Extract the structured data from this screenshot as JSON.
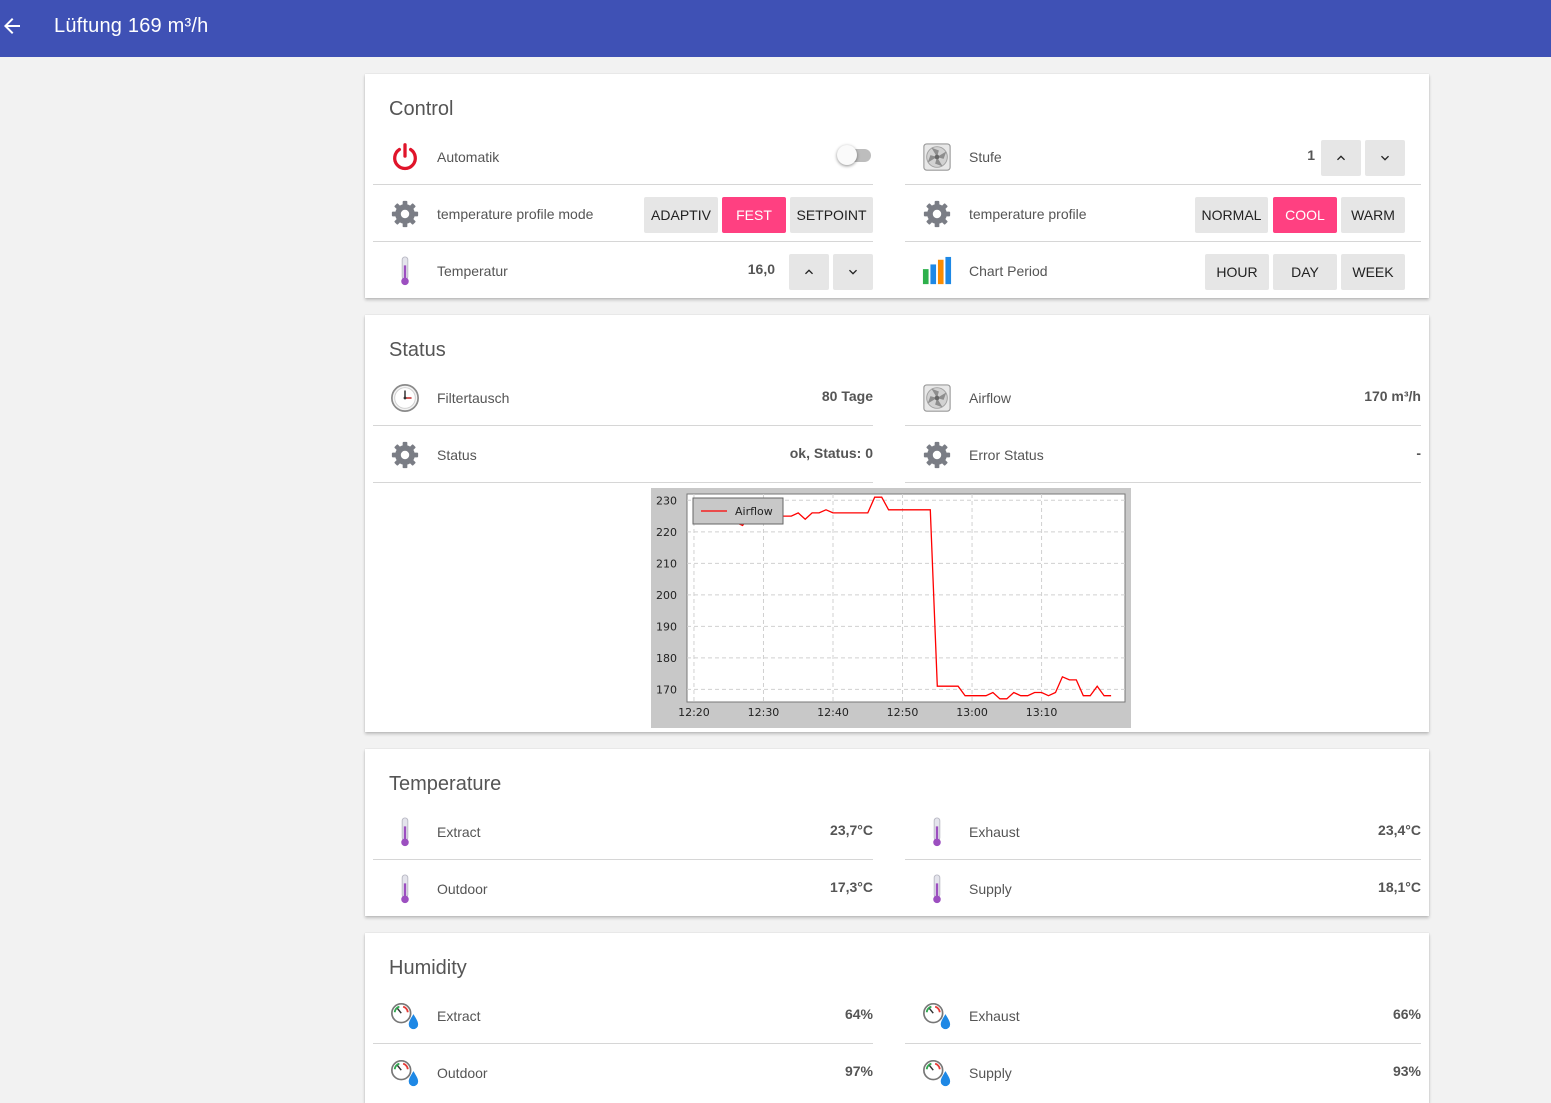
{
  "header": {
    "title": "Lüftung 169 m³/h"
  },
  "control": {
    "title": "Control",
    "automatik": {
      "label": "Automatik",
      "enabled": false
    },
    "stufe": {
      "label": "Stufe",
      "value": "1"
    },
    "profile_mode": {
      "label": "temperature profile mode",
      "options": [
        "ADAPTIV",
        "FEST",
        "SETPOINT"
      ],
      "selected": "FEST"
    },
    "profile": {
      "label": "temperature profile",
      "options": [
        "NORMAL",
        "COOL",
        "WARM"
      ],
      "selected": "COOL"
    },
    "temperatur": {
      "label": "Temperatur",
      "value": "16,0"
    },
    "chart_period": {
      "label": "Chart Period",
      "options": [
        "HOUR",
        "DAY",
        "WEEK"
      ]
    }
  },
  "status": {
    "title": "Status",
    "filtertausch": {
      "label": "Filtertausch",
      "value": "80 Tage"
    },
    "airflow": {
      "label": "Airflow",
      "value": "170 m³/h"
    },
    "status": {
      "label": "Status",
      "value": "ok, Status: 0"
    },
    "error_status": {
      "label": "Error Status",
      "value": "-"
    }
  },
  "chart_data": {
    "type": "line",
    "title": "",
    "xlabel": "",
    "ylabel": "",
    "legend_position": "top-left",
    "grid": true,
    "x_ticks": [
      "12:20",
      "12:30",
      "12:40",
      "12:50",
      "13:00",
      "13:10"
    ],
    "y_ticks": [
      170,
      180,
      190,
      200,
      210,
      220,
      230
    ],
    "xlim": [
      "12:19",
      "13:22"
    ],
    "ylim": [
      166,
      232
    ],
    "series": [
      {
        "name": "Airflow",
        "color": "#ff0000",
        "x": [
          "12:26",
          "12:27",
          "12:28",
          "12:29",
          "12:30",
          "12:31",
          "12:32",
          "12:33",
          "12:34",
          "12:35",
          "12:36",
          "12:37",
          "12:38",
          "12:39",
          "12:40",
          "12:41",
          "12:42",
          "12:43",
          "12:44",
          "12:45",
          "12:46",
          "12:47",
          "12:48",
          "12:49",
          "12:50",
          "12:51",
          "12:52",
          "12:53",
          "12:54",
          "12:55",
          "12:56",
          "12:57",
          "12:58",
          "12:59",
          "13:00",
          "13:01",
          "13:02",
          "13:03",
          "13:04",
          "13:05",
          "13:06",
          "13:07",
          "13:08",
          "13:09",
          "13:10",
          "13:11",
          "13:12",
          "13:13",
          "13:14",
          "13:15",
          "13:16",
          "13:17",
          "13:18",
          "13:19",
          "13:20"
        ],
        "values": [
          223,
          222,
          225,
          224,
          226,
          225,
          225,
          225,
          225,
          226,
          224,
          226,
          226,
          227,
          226,
          226,
          226,
          226,
          226,
          226,
          231,
          231,
          227,
          227,
          227,
          227,
          227,
          227,
          227,
          171,
          171,
          171,
          171,
          168,
          168,
          168,
          168,
          169,
          167,
          167,
          169,
          168,
          168,
          169,
          169,
          168,
          169,
          174,
          173,
          173,
          168,
          168,
          171,
          168,
          168
        ]
      }
    ]
  },
  "temperature": {
    "title": "Temperature",
    "extract": {
      "label": "Extract",
      "value": "23,7°C"
    },
    "exhaust": {
      "label": "Exhaust",
      "value": "23,4°C"
    },
    "outdoor": {
      "label": "Outdoor",
      "value": "17,3°C"
    },
    "supply": {
      "label": "Supply",
      "value": "18,1°C"
    }
  },
  "humidity": {
    "title": "Humidity",
    "extract": {
      "label": "Extract",
      "value": "64%"
    },
    "exhaust": {
      "label": "Exhaust",
      "value": "66%"
    },
    "outdoor": {
      "label": "Outdoor",
      "value": "97%"
    },
    "supply": {
      "label": "Supply",
      "value": "93%"
    }
  },
  "colors": {
    "appbar": "#3f51b5",
    "accent": "#ff4081",
    "power": "#e0142a",
    "line": "#ff0000",
    "thermo": "#9c4fc0"
  }
}
